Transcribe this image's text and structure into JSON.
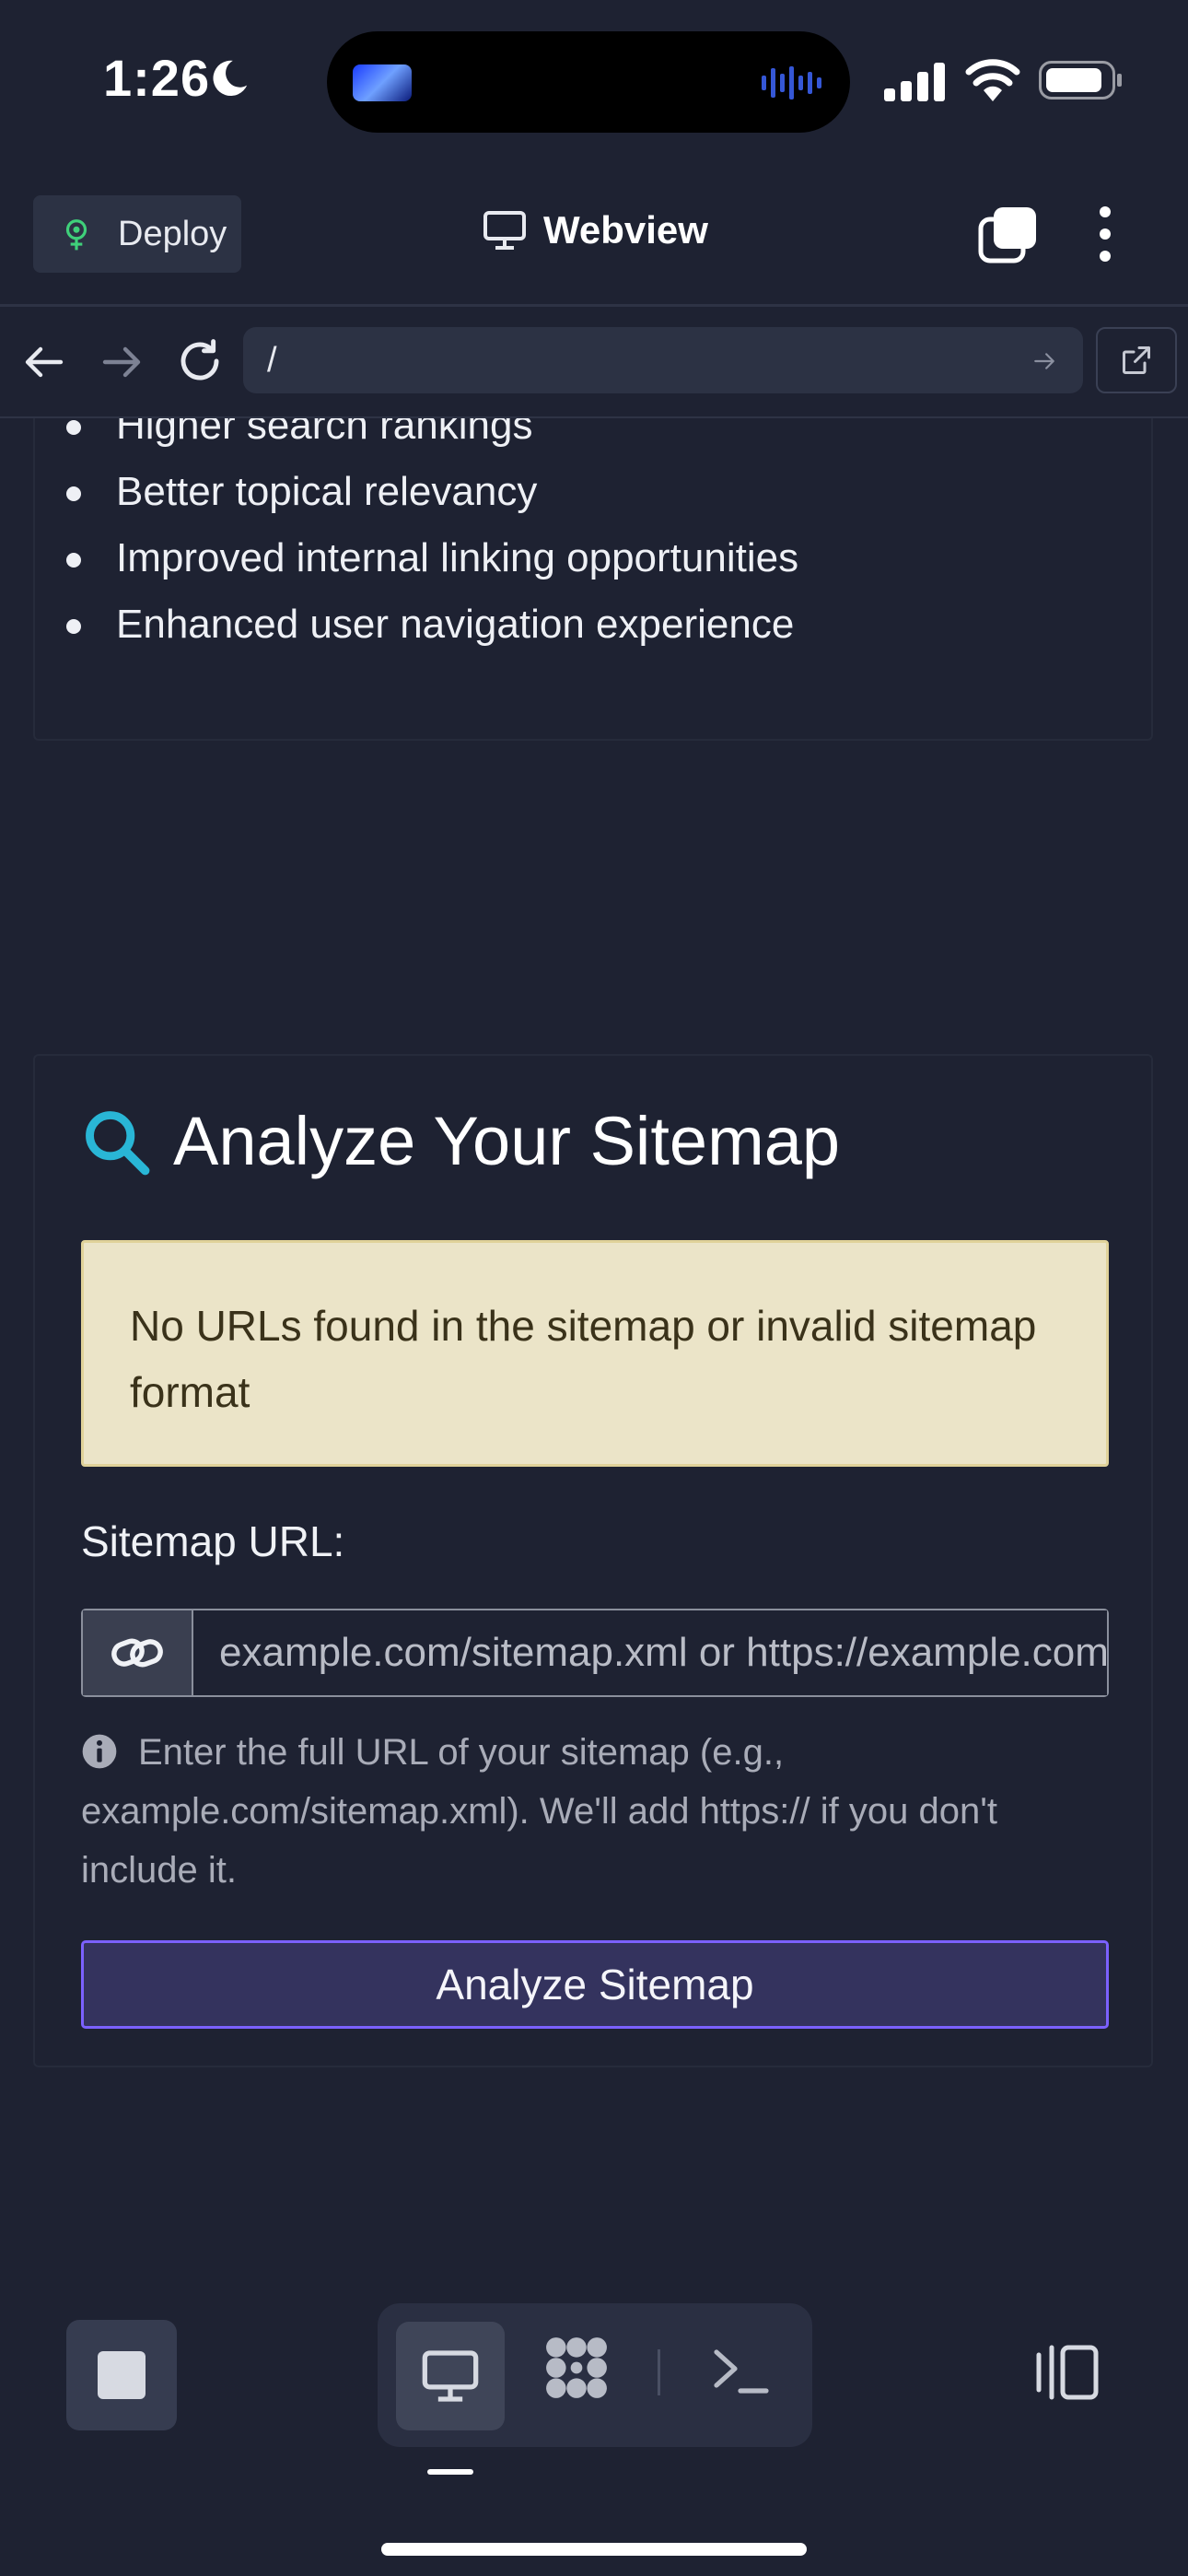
{
  "status_bar": {
    "time": "1:26"
  },
  "app_bar": {
    "deploy_label": "Deploy",
    "title": "Webview"
  },
  "url_bar": {
    "path": "/"
  },
  "benefits": [
    "Higher search rankings",
    "Better topical relevancy",
    "Improved internal linking opportunities",
    "Enhanced user navigation experience"
  ],
  "analyzer": {
    "heading": "Analyze Your Sitemap",
    "alert": "No URLs found in the sitemap or invalid sitemap format",
    "field_label": "Sitemap URL:",
    "placeholder": "example.com/sitemap.xml or https://example.com/sitemap.xml",
    "help": "Enter the full URL of your sitemap (e.g., example.com/sitemap.xml). We'll add https:// if you don't include it.",
    "button": "Analyze Sitemap"
  },
  "colors": {
    "background": "#1e2232",
    "accent_cyan": "#29b6d6",
    "alert_bg": "#ebe4c8",
    "button_border": "#7b61ff",
    "deploy_icon": "#3fd07a"
  },
  "icons": {
    "deploy": "deploy-icon",
    "webview": "monitor-icon",
    "tabs": "tabs-icon",
    "menu": "kebab-menu-icon",
    "back": "arrow-left-icon",
    "forward": "arrow-right-icon",
    "reload": "reload-icon",
    "open_external": "external-link-icon",
    "search": "search-icon",
    "link": "link-icon",
    "info": "info-icon",
    "stop": "stop-icon",
    "apps": "apps-icon",
    "shell": "terminal-icon",
    "split": "split-view-icon"
  }
}
